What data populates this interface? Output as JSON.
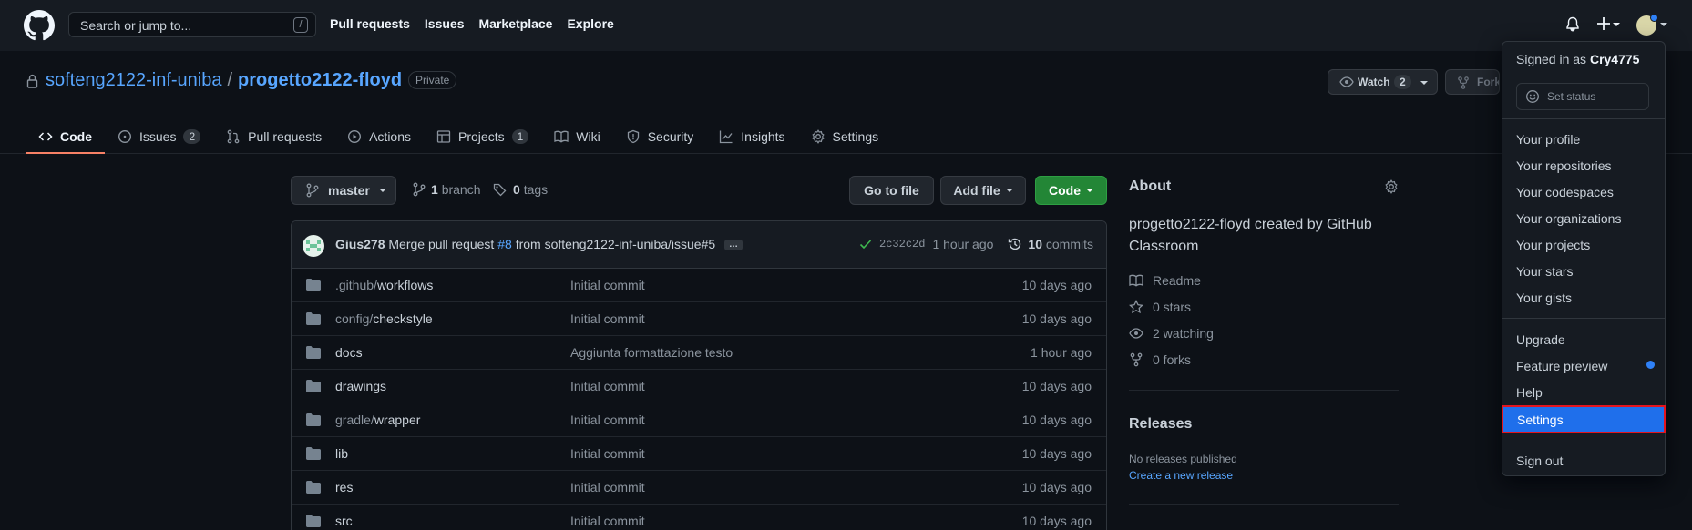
{
  "header": {
    "search_placeholder": "Search or jump to...",
    "search_shortcut": "/",
    "nav": [
      "Pull requests",
      "Issues",
      "Marketplace",
      "Explore"
    ]
  },
  "repo": {
    "owner": "softeng2122-inf-uniba",
    "separator": "/",
    "name": "progetto2122-floyd",
    "visibility": "Private",
    "watch_label": "Watch",
    "watch_count": "2",
    "fork_label": "Fork"
  },
  "tabs": [
    {
      "label": "Code",
      "count": null
    },
    {
      "label": "Issues",
      "count": "2"
    },
    {
      "label": "Pull requests",
      "count": null
    },
    {
      "label": "Actions",
      "count": null
    },
    {
      "label": "Projects",
      "count": "1"
    },
    {
      "label": "Wiki",
      "count": null
    },
    {
      "label": "Security",
      "count": null
    },
    {
      "label": "Insights",
      "count": null
    },
    {
      "label": "Settings",
      "count": null
    }
  ],
  "branch_bar": {
    "branch": "master",
    "branch_count": "1",
    "branch_word": "branch",
    "tag_count": "0",
    "tag_word": "tags",
    "go_to_file": "Go to file",
    "add_file": "Add file",
    "code": "Code"
  },
  "commit": {
    "author": "Gius278",
    "message_pre": "Merge pull request",
    "pr": "#8",
    "message_post": "from softeng2122-inf-uniba/issue#5",
    "ellipsis": "…",
    "sha": "2c32c2d",
    "time": "1 hour ago",
    "commit_count": "10",
    "commit_word": "commits"
  },
  "files": [
    {
      "dim": ".github/",
      "name": "workflows",
      "message": "Initial commit",
      "age": "10 days ago"
    },
    {
      "dim": "config/",
      "name": "checkstyle",
      "message": "Initial commit",
      "age": "10 days ago"
    },
    {
      "dim": "",
      "name": "docs",
      "message": "Aggiunta formattazione testo",
      "age": "1 hour ago"
    },
    {
      "dim": "",
      "name": "drawings",
      "message": "Initial commit",
      "age": "10 days ago"
    },
    {
      "dim": "gradle/",
      "name": "wrapper",
      "message": "Initial commit",
      "age": "10 days ago"
    },
    {
      "dim": "",
      "name": "lib",
      "message": "Initial commit",
      "age": "10 days ago"
    },
    {
      "dim": "",
      "name": "res",
      "message": "Initial commit",
      "age": "10 days ago"
    },
    {
      "dim": "",
      "name": "src",
      "message": "Initial commit",
      "age": "10 days ago"
    }
  ],
  "about": {
    "title": "About",
    "description": "progetto2122-floyd created by GitHub Classroom",
    "readme": "Readme",
    "stars": "0 stars",
    "watching": "2 watching",
    "forks": "0 forks"
  },
  "releases": {
    "title": "Releases",
    "none": "No releases published",
    "create_link": "Create a new release"
  },
  "user_menu": {
    "signed_in_prefix": "Signed in as",
    "username": "Cry4775",
    "set_status": "Set status",
    "profile_items": [
      "Your profile",
      "Your repositories",
      "Your codespaces",
      "Your organizations",
      "Your projects",
      "Your stars",
      "Your gists"
    ],
    "upgrade": "Upgrade",
    "feature_preview": "Feature preview",
    "help": "Help",
    "settings": "Settings",
    "sign_out": "Sign out"
  },
  "colors": {
    "accent": "#58a6ff",
    "code_button": "#238636",
    "selected_item": "#1f6feb",
    "highlight_border": "#e5141d"
  }
}
